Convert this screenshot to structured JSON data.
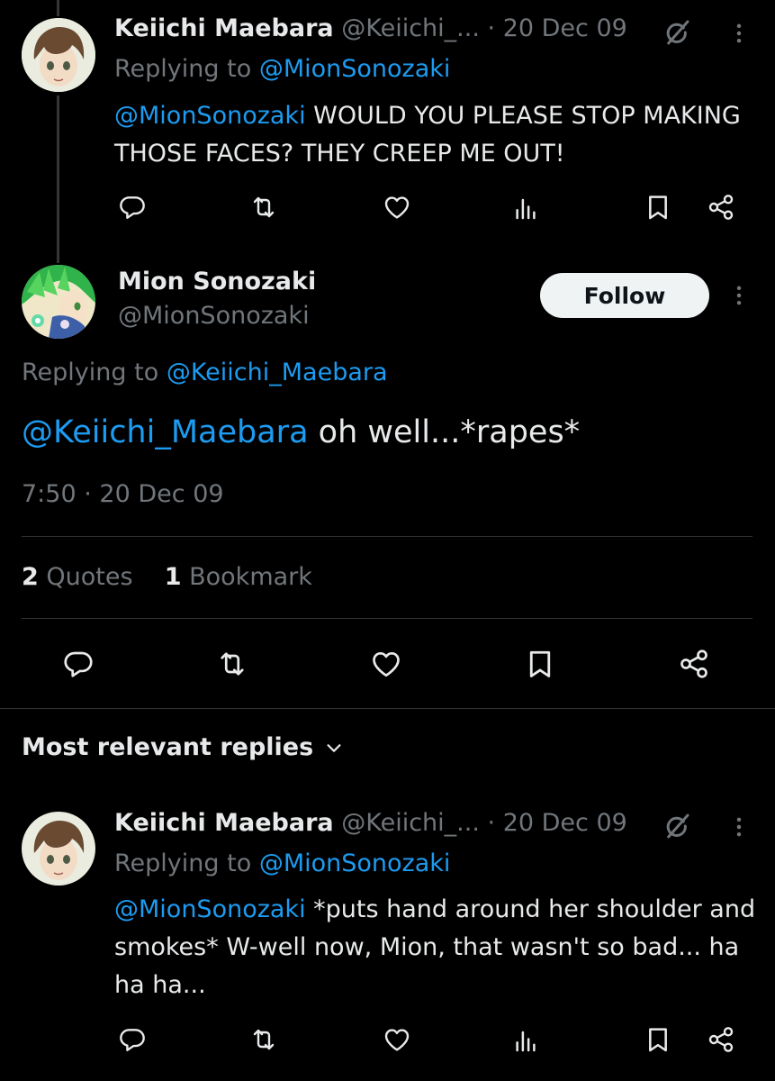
{
  "tweet1": {
    "display_name": "Keiichi Maebara",
    "handle": "@Keiichi_...",
    "sep": "·",
    "date": "20 Dec 09",
    "replying_prefix": "Replying to",
    "replying_to": "@MionSonozaki",
    "mention": "@MionSonozaki",
    "text": " WOULD YOU PLEASE STOP MAKING THOSE FACES? THEY CREEP ME OUT!"
  },
  "main_tweet": {
    "display_name": "Mion Sonozaki",
    "handle": "@MionSonozaki",
    "follow_label": "Follow",
    "replying_prefix": "Replying to",
    "replying_to": "@Keiichi_Maebara",
    "mention": "@Keiichi_Maebara",
    "text": " oh well...*rapes*",
    "time": "7:50",
    "sep": "·",
    "date": "20 Dec 09",
    "stats": {
      "quotes_count": "2",
      "quotes_label": "Quotes",
      "bookmarks_count": "1",
      "bookmarks_label": "Bookmark"
    }
  },
  "replies_header": {
    "label": "Most relevant replies"
  },
  "tweet3": {
    "display_name": "Keiichi Maebara",
    "handle": "@Keiichi_...",
    "sep": "·",
    "date": "20 Dec 09",
    "replying_prefix": "Replying to",
    "replying_to": "@MionSonozaki",
    "mention": "@MionSonozaki",
    "text": " *puts hand around her shoulder and smokes* W-well now, Mion, that wasn't so bad... ha ha ha..."
  },
  "icons": {
    "reply": "reply-icon",
    "retweet": "retweet-icon",
    "like": "heart-icon",
    "views": "views-icon",
    "bookmark": "bookmark-icon",
    "share": "share-icon",
    "more": "more-icon",
    "grok": "grok-icon",
    "chevron": "chevron-down-icon"
  },
  "colors": {
    "background": "#000000",
    "text": "#e7e9ea",
    "secondary": "#71767b",
    "link": "#1d9bf0",
    "divider": "#2f3336"
  }
}
